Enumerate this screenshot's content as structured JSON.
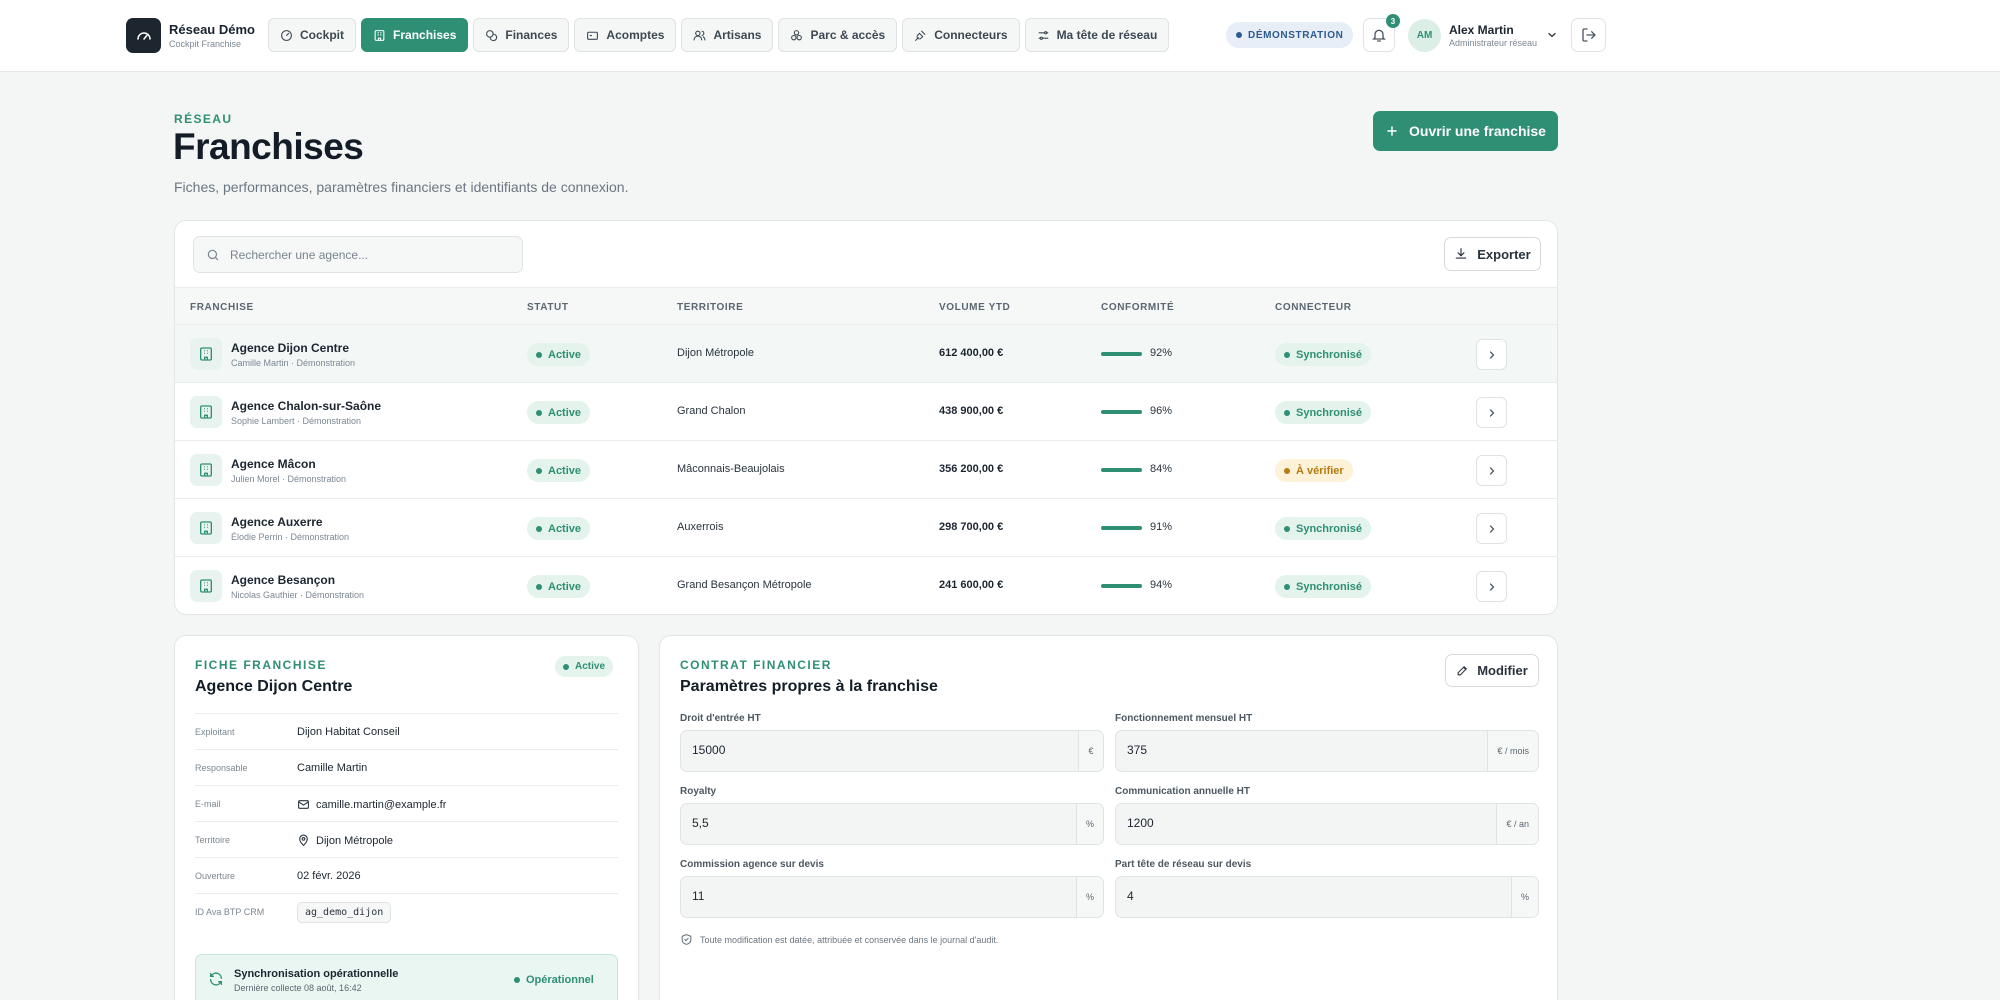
{
  "brand": {
    "name": "Réseau Démo",
    "subtitle": "Cockpit Franchise"
  },
  "nav": [
    {
      "label": "Cockpit",
      "icon": "gauge-icon"
    },
    {
      "label": "Franchises",
      "icon": "building-icon",
      "active": true
    },
    {
      "label": "Finances",
      "icon": "coins-icon"
    },
    {
      "label": "Acomptes",
      "icon": "wallet-icon"
    },
    {
      "label": "Artisans",
      "icon": "users-icon"
    },
    {
      "label": "Parc & accès",
      "icon": "boxes-icon"
    },
    {
      "label": "Connecteurs",
      "icon": "plug-icon"
    },
    {
      "label": "Ma tête de réseau",
      "icon": "sliders-icon"
    }
  ],
  "header_right": {
    "demo_badge": "DÉMONSTRATION",
    "notification_count": "3",
    "user_initials": "AM",
    "user_name": "Alex Martin",
    "user_role": "Administrateur réseau"
  },
  "page": {
    "eyebrow": "RÉSEAU",
    "title": "Franchises",
    "subtitle": "Fiches, performances, paramètres financiers et identifiants de connexion.",
    "primary_action": "Ouvrir une franchise"
  },
  "table": {
    "search_placeholder": "Rechercher une agence...",
    "export_label": "Exporter",
    "columns": [
      "FRANCHISE",
      "STATUT",
      "TERRITOIRE",
      "VOLUME YTD",
      "CONFORMITÉ",
      "CONNECTEUR"
    ],
    "rows": [
      {
        "name": "Agence Dijon Centre",
        "sub": "Camille Martin · Démonstration",
        "status": "Active",
        "territory": "Dijon Métropole",
        "volume": "612 400,00 €",
        "compliance": 92,
        "compliance_label": "92%",
        "connector": "Synchronisé",
        "connector_state": "ok"
      },
      {
        "name": "Agence Chalon-sur-Saône",
        "sub": "Sophie Lambert · Démonstration",
        "status": "Active",
        "territory": "Grand Chalon",
        "volume": "438 900,00 €",
        "compliance": 96,
        "compliance_label": "96%",
        "connector": "Synchronisé",
        "connector_state": "ok"
      },
      {
        "name": "Agence Mâcon",
        "sub": "Julien Morel · Démonstration",
        "status": "Active",
        "territory": "Mâconnais-Beaujolais",
        "volume": "356 200,00 €",
        "compliance": 84,
        "compliance_label": "84%",
        "connector": "À vérifier",
        "connector_state": "warn"
      },
      {
        "name": "Agence Auxerre",
        "sub": "Élodie Perrin · Démonstration",
        "status": "Active",
        "territory": "Auxerrois",
        "volume": "298 700,00 €",
        "compliance": 91,
        "compliance_label": "91%",
        "connector": "Synchronisé",
        "connector_state": "ok"
      },
      {
        "name": "Agence Besançon",
        "sub": "Nicolas Gauthier · Démonstration",
        "status": "Active",
        "territory": "Grand Besançon Métropole",
        "volume": "241 600,00 €",
        "compliance": 94,
        "compliance_label": "94%",
        "connector": "Synchronisé",
        "connector_state": "ok"
      }
    ]
  },
  "fiche": {
    "eyebrow": "FICHE FRANCHISE",
    "title": "Agence Dijon Centre",
    "status": "Active",
    "fields": [
      {
        "label": "Exploitant",
        "value": "Dijon Habitat Conseil"
      },
      {
        "label": "Responsable",
        "value": "Camille Martin"
      },
      {
        "label": "E-mail",
        "value": "camille.martin@example.fr",
        "icon": "mail-icon"
      },
      {
        "label": "Territoire",
        "value": "Dijon Métropole",
        "icon": "map-pin-icon"
      },
      {
        "label": "Ouverture",
        "value": "02 févr. 2026"
      },
      {
        "label": "ID Ava BTP CRM",
        "value": "ag_demo_dijon",
        "code": true
      }
    ],
    "sync": {
      "title": "Synchronisation opérationnelle",
      "subtitle": "Dernière collecte 08 août, 16:42",
      "status": "Opérationnel"
    }
  },
  "contract": {
    "eyebrow": "CONTRAT FINANCIER",
    "title": "Paramètres propres à la franchise",
    "modify_label": "Modifier",
    "fields": [
      {
        "label": "Droit d'entrée HT",
        "value": "15000",
        "unit": "€"
      },
      {
        "label": "Fonctionnement mensuel HT",
        "value": "375",
        "unit": "€ / mois"
      },
      {
        "label": "Royalty",
        "value": "5,5",
        "unit": "%"
      },
      {
        "label": "Communication annuelle HT",
        "value": "1200",
        "unit": "€ / an"
      },
      {
        "label": "Commission agence sur devis",
        "value": "11",
        "unit": "%"
      },
      {
        "label": "Part tête de réseau sur devis",
        "value": "4",
        "unit": "%"
      }
    ],
    "audit_note": "Toute modification est datée, attribuée et conservée dans le journal d'audit."
  },
  "colors": {
    "accent": "#2f8f74",
    "warn": "#b77a12",
    "dark": "#1d262e",
    "demo": "#2c5b8f"
  }
}
